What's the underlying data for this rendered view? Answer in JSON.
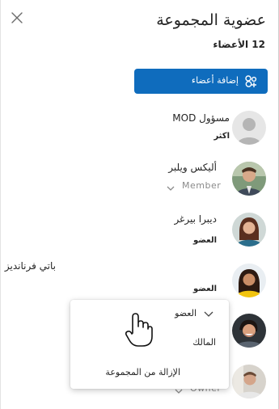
{
  "header": {
    "title": "عضوية المجموعة",
    "member_count": "12 الأعضاء",
    "close_icon": "close-icon"
  },
  "actions": {
    "add_members_label": "إضافة أعضاء",
    "add_members_icon": "people-add-icon"
  },
  "members": [
    {
      "name": "مسؤول MOD",
      "role": "اكثر"
    },
    {
      "name": "أليكس ويلبر",
      "role": "Member"
    },
    {
      "name": "ديبرا بيرغر",
      "role": "العضو"
    },
    {
      "name": "باتي فرنانديز",
      "role": "العضو"
    },
    {
      "name": "",
      "role": ""
    },
    {
      "name": "",
      "role": "Owner"
    }
  ],
  "role_menu": {
    "current": "العضو",
    "options": [
      "المالك",
      "الإزالة من المجموعة"
    ]
  },
  "colors": {
    "accent": "#0f6cbd"
  }
}
